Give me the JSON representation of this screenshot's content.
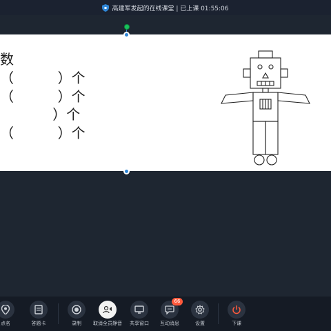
{
  "titlebar": {
    "text": "高建军发起的在线课堂 | 已上课 01:55:06"
  },
  "slide": {
    "lines": [
      "数",
      "（          ）个",
      "（          ）个",
      "            ）个",
      "（          ）个"
    ]
  },
  "toolbar": {
    "items": [
      {
        "label": "点名",
        "icon": "location-pin-icon"
      },
      {
        "label": "答题卡",
        "icon": "answer-card-icon"
      },
      {
        "label": "录制",
        "icon": "record-icon"
      },
      {
        "label": "取消全员静音",
        "icon": "unmute-all-icon"
      },
      {
        "label": "共享窗口",
        "icon": "share-window-icon"
      },
      {
        "label": "互动消息",
        "icon": "chat-bubble-icon",
        "badge": "66"
      },
      {
        "label": "设置",
        "icon": "gear-icon"
      },
      {
        "label": "下课",
        "icon": "power-icon"
      }
    ]
  },
  "colors": {
    "accent": "#2f86d6",
    "end_class": "#ff5a3c",
    "badge": "#ff5a3c"
  }
}
